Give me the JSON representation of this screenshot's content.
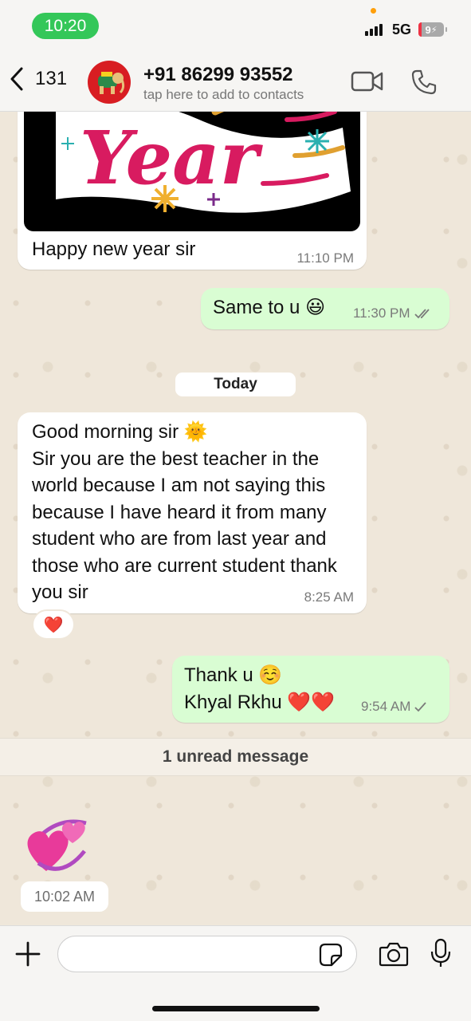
{
  "status_bar": {
    "time": "10:20",
    "network": "5G",
    "battery": "9"
  },
  "header": {
    "back_count": "131",
    "contact_name": "+91 86299 93552",
    "contact_subtitle": "tap here to add to contacts"
  },
  "messages": [
    {
      "direction": "in",
      "type": "image",
      "image_text": "New Year",
      "caption": "Happy new year sir",
      "time": "11:10 PM"
    },
    {
      "direction": "out",
      "text": "Same to u 😃",
      "time": "11:30 PM",
      "status": "read"
    },
    {
      "direction": "in",
      "lines": [
        "Good morning sir 🌞",
        "Sir you are the best teacher in the world because I am not saying this because I have heard it from many student who are from last year and those who are current student thank you sir"
      ],
      "time": "8:25 AM",
      "reaction": "❤️"
    },
    {
      "direction": "out",
      "lines": [
        "Thank u ☺️",
        "Khyal Rkhu ❤️❤️"
      ],
      "time": "9:54 AM",
      "status": "delivered"
    },
    {
      "direction": "in",
      "type": "sticker",
      "sticker": "hearts",
      "time": "10:02 AM"
    }
  ],
  "day_divider": "Today",
  "unread_divider": "1 unread message",
  "input": {
    "placeholder": ""
  },
  "colors": {
    "outgoing_bubble": "#d9fdd3",
    "incoming_bubble": "#ffffff",
    "accent_green": "#34c759",
    "read_tick": "#53bdeb"
  }
}
